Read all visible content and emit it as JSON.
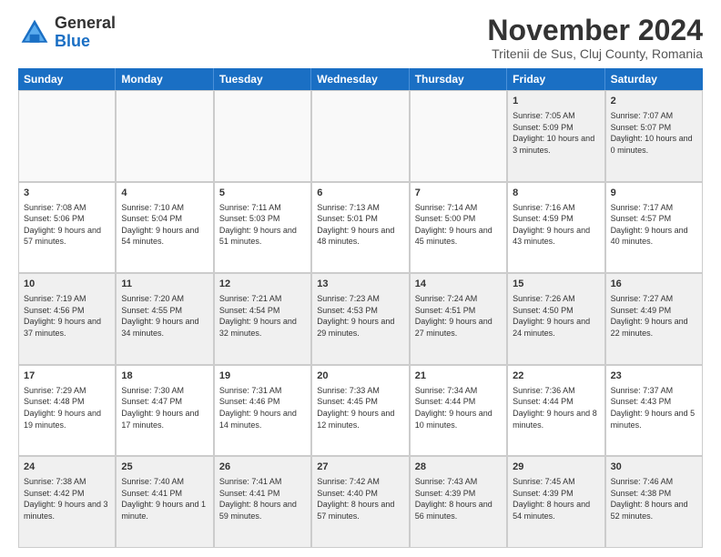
{
  "logo": {
    "general": "General",
    "blue": "Blue"
  },
  "header": {
    "month": "November 2024",
    "location": "Tritenii de Sus, Cluj County, Romania"
  },
  "weekdays": [
    "Sunday",
    "Monday",
    "Tuesday",
    "Wednesday",
    "Thursday",
    "Friday",
    "Saturday"
  ],
  "weeks": [
    [
      {
        "day": "",
        "empty": true
      },
      {
        "day": "",
        "empty": true
      },
      {
        "day": "",
        "empty": true
      },
      {
        "day": "",
        "empty": true
      },
      {
        "day": "",
        "empty": true
      },
      {
        "day": "1",
        "sunrise": "Sunrise: 7:05 AM",
        "sunset": "Sunset: 5:09 PM",
        "daylight": "Daylight: 10 hours and 3 minutes."
      },
      {
        "day": "2",
        "sunrise": "Sunrise: 7:07 AM",
        "sunset": "Sunset: 5:07 PM",
        "daylight": "Daylight: 10 hours and 0 minutes."
      }
    ],
    [
      {
        "day": "3",
        "sunrise": "Sunrise: 7:08 AM",
        "sunset": "Sunset: 5:06 PM",
        "daylight": "Daylight: 9 hours and 57 minutes."
      },
      {
        "day": "4",
        "sunrise": "Sunrise: 7:10 AM",
        "sunset": "Sunset: 5:04 PM",
        "daylight": "Daylight: 9 hours and 54 minutes."
      },
      {
        "day": "5",
        "sunrise": "Sunrise: 7:11 AM",
        "sunset": "Sunset: 5:03 PM",
        "daylight": "Daylight: 9 hours and 51 minutes."
      },
      {
        "day": "6",
        "sunrise": "Sunrise: 7:13 AM",
        "sunset": "Sunset: 5:01 PM",
        "daylight": "Daylight: 9 hours and 48 minutes."
      },
      {
        "day": "7",
        "sunrise": "Sunrise: 7:14 AM",
        "sunset": "Sunset: 5:00 PM",
        "daylight": "Daylight: 9 hours and 45 minutes."
      },
      {
        "day": "8",
        "sunrise": "Sunrise: 7:16 AM",
        "sunset": "Sunset: 4:59 PM",
        "daylight": "Daylight: 9 hours and 43 minutes."
      },
      {
        "day": "9",
        "sunrise": "Sunrise: 7:17 AM",
        "sunset": "Sunset: 4:57 PM",
        "daylight": "Daylight: 9 hours and 40 minutes."
      }
    ],
    [
      {
        "day": "10",
        "sunrise": "Sunrise: 7:19 AM",
        "sunset": "Sunset: 4:56 PM",
        "daylight": "Daylight: 9 hours and 37 minutes."
      },
      {
        "day": "11",
        "sunrise": "Sunrise: 7:20 AM",
        "sunset": "Sunset: 4:55 PM",
        "daylight": "Daylight: 9 hours and 34 minutes."
      },
      {
        "day": "12",
        "sunrise": "Sunrise: 7:21 AM",
        "sunset": "Sunset: 4:54 PM",
        "daylight": "Daylight: 9 hours and 32 minutes."
      },
      {
        "day": "13",
        "sunrise": "Sunrise: 7:23 AM",
        "sunset": "Sunset: 4:53 PM",
        "daylight": "Daylight: 9 hours and 29 minutes."
      },
      {
        "day": "14",
        "sunrise": "Sunrise: 7:24 AM",
        "sunset": "Sunset: 4:51 PM",
        "daylight": "Daylight: 9 hours and 27 minutes."
      },
      {
        "day": "15",
        "sunrise": "Sunrise: 7:26 AM",
        "sunset": "Sunset: 4:50 PM",
        "daylight": "Daylight: 9 hours and 24 minutes."
      },
      {
        "day": "16",
        "sunrise": "Sunrise: 7:27 AM",
        "sunset": "Sunset: 4:49 PM",
        "daylight": "Daylight: 9 hours and 22 minutes."
      }
    ],
    [
      {
        "day": "17",
        "sunrise": "Sunrise: 7:29 AM",
        "sunset": "Sunset: 4:48 PM",
        "daylight": "Daylight: 9 hours and 19 minutes."
      },
      {
        "day": "18",
        "sunrise": "Sunrise: 7:30 AM",
        "sunset": "Sunset: 4:47 PM",
        "daylight": "Daylight: 9 hours and 17 minutes."
      },
      {
        "day": "19",
        "sunrise": "Sunrise: 7:31 AM",
        "sunset": "Sunset: 4:46 PM",
        "daylight": "Daylight: 9 hours and 14 minutes."
      },
      {
        "day": "20",
        "sunrise": "Sunrise: 7:33 AM",
        "sunset": "Sunset: 4:45 PM",
        "daylight": "Daylight: 9 hours and 12 minutes."
      },
      {
        "day": "21",
        "sunrise": "Sunrise: 7:34 AM",
        "sunset": "Sunset: 4:44 PM",
        "daylight": "Daylight: 9 hours and 10 minutes."
      },
      {
        "day": "22",
        "sunrise": "Sunrise: 7:36 AM",
        "sunset": "Sunset: 4:44 PM",
        "daylight": "Daylight: 9 hours and 8 minutes."
      },
      {
        "day": "23",
        "sunrise": "Sunrise: 7:37 AM",
        "sunset": "Sunset: 4:43 PM",
        "daylight": "Daylight: 9 hours and 5 minutes."
      }
    ],
    [
      {
        "day": "24",
        "sunrise": "Sunrise: 7:38 AM",
        "sunset": "Sunset: 4:42 PM",
        "daylight": "Daylight: 9 hours and 3 minutes."
      },
      {
        "day": "25",
        "sunrise": "Sunrise: 7:40 AM",
        "sunset": "Sunset: 4:41 PM",
        "daylight": "Daylight: 9 hours and 1 minute."
      },
      {
        "day": "26",
        "sunrise": "Sunrise: 7:41 AM",
        "sunset": "Sunset: 4:41 PM",
        "daylight": "Daylight: 8 hours and 59 minutes."
      },
      {
        "day": "27",
        "sunrise": "Sunrise: 7:42 AM",
        "sunset": "Sunset: 4:40 PM",
        "daylight": "Daylight: 8 hours and 57 minutes."
      },
      {
        "day": "28",
        "sunrise": "Sunrise: 7:43 AM",
        "sunset": "Sunset: 4:39 PM",
        "daylight": "Daylight: 8 hours and 56 minutes."
      },
      {
        "day": "29",
        "sunrise": "Sunrise: 7:45 AM",
        "sunset": "Sunset: 4:39 PM",
        "daylight": "Daylight: 8 hours and 54 minutes."
      },
      {
        "day": "30",
        "sunrise": "Sunrise: 7:46 AM",
        "sunset": "Sunset: 4:38 PM",
        "daylight": "Daylight: 8 hours and 52 minutes."
      }
    ]
  ]
}
